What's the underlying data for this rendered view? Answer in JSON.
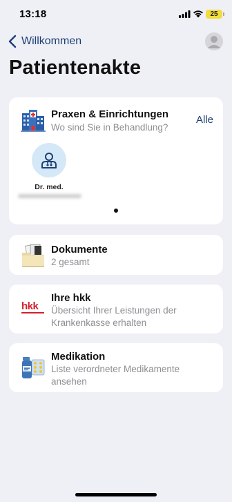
{
  "status_bar": {
    "time": "13:18",
    "battery": "25"
  },
  "nav": {
    "back_label": "Willkommen"
  },
  "page": {
    "title": "Patientenakte"
  },
  "cards": {
    "praxen": {
      "title": "Praxen & Einrichtungen",
      "subtitle": "Wo sind Sie in Behandlung?",
      "all_label": "Alle",
      "practices": [
        {
          "name": "Dr. med."
        }
      ]
    },
    "dokumente": {
      "title": "Dokumente",
      "subtitle": "2 gesamt"
    },
    "hkk": {
      "title": "Ihre hkk",
      "subtitle": "Übersicht Ihrer Leistungen der Krankenkasse erhalten",
      "logo_text": "hkk"
    },
    "medikation": {
      "title": "Medikation",
      "subtitle": "Liste verordneter Medikamente ansehen"
    }
  },
  "colors": {
    "accent": "#1d3f73",
    "background": "#efeff6",
    "hkk_red": "#d0202e"
  }
}
